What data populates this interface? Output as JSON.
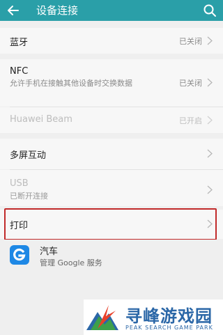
{
  "header": {
    "title": "设备连接",
    "back_icon": "back-arrow-icon",
    "search_icon": "search-icon",
    "color": "#2a9fa8"
  },
  "settings": {
    "bluetooth": {
      "label": "蓝牙",
      "value": "已关闭"
    },
    "nfc": {
      "label": "NFC",
      "subtitle": "允许手机在接触其他设备时交换数据",
      "value": "已关闭"
    },
    "huawei_beam": {
      "label": "Huawei Beam",
      "value": "已开启"
    },
    "multi_screen": {
      "label": "多屏互动"
    },
    "usb": {
      "label": "USB",
      "subtitle": "已断开连接"
    },
    "print": {
      "label": "打印"
    }
  },
  "app_item": {
    "title": "汽车",
    "subtitle": "管理 Google 服务",
    "icon": "google-g-icon",
    "icon_color": "#1e88e5"
  },
  "watermark": {
    "chinese": "寻峰游戏园",
    "english": "PEAK SEARCH GAME PARK"
  },
  "highlight_color": "#c12a2a"
}
